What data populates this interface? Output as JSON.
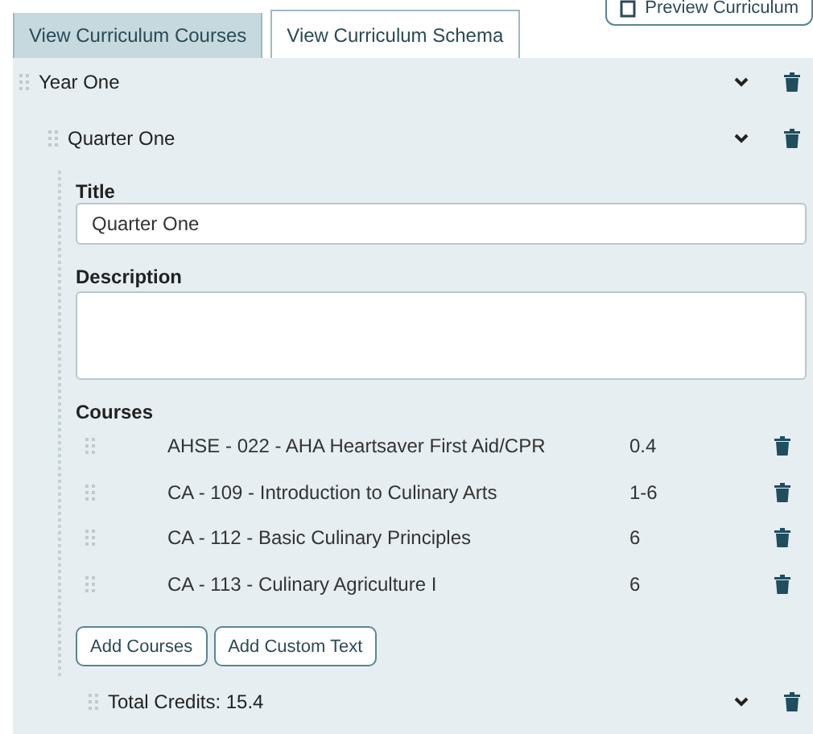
{
  "tabs": [
    {
      "label": "View Curriculum Courses",
      "selected": false
    },
    {
      "label": "View Curriculum Schema",
      "selected": true
    }
  ],
  "preview_button": {
    "label": "Preview Curriculum"
  },
  "year": {
    "title": "Year One"
  },
  "quarter": {
    "title": "Quarter One"
  },
  "form": {
    "title_label": "Title",
    "title_value": "Quarter One",
    "description_label": "Description",
    "courses_label": "Courses"
  },
  "courses": [
    {
      "name": "AHSE - 022 - AHA Heartsaver First Aid/CPR",
      "credits": "0.4"
    },
    {
      "name": "CA - 109 - Introduction to Culinary Arts",
      "credits": "1-6"
    },
    {
      "name": "CA - 112 - Basic Culinary Principles",
      "credits": "6"
    },
    {
      "name": "CA - 113 - Culinary Agriculture I",
      "credits": "6"
    }
  ],
  "buttons": [
    "Add Courses",
    "Add Custom Text"
  ],
  "total": {
    "label": "Total Credits: 15.4"
  }
}
